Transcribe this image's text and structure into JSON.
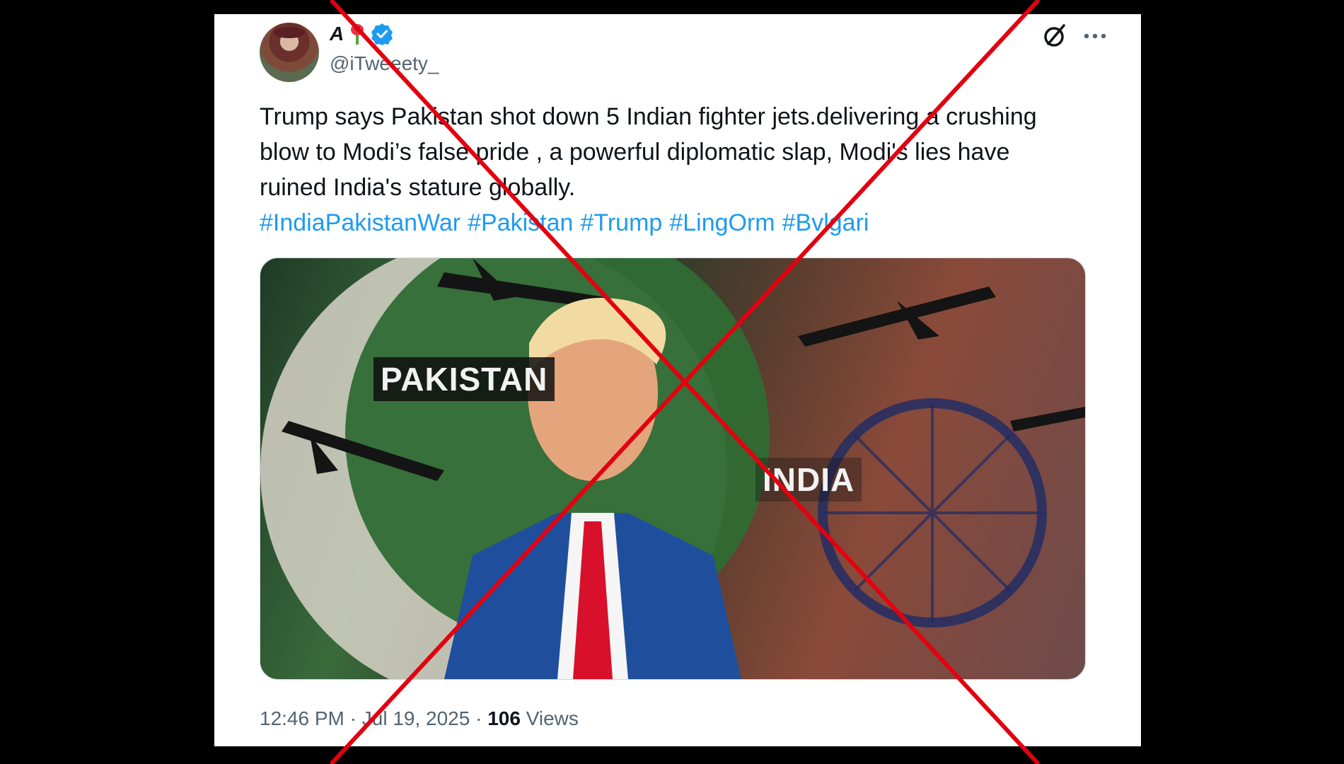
{
  "tweet": {
    "display_name": "A",
    "handle": "@iTweeety_",
    "verified": true,
    "text_lines": [
      "Trump says Pakistan shot down 5 Indian fighter jets.delivering a crushing",
      "blow to Modi’s false pride , a powerful diplomatic slap, Modi's lies have",
      "ruined India's stature globally."
    ],
    "hashtags": [
      "#IndiaPakistanWar",
      "#Pakistan",
      "#Trump",
      "#LingOrm",
      "#Bvlgari"
    ],
    "media": {
      "label_left": "PAKISTAN",
      "label_right": "INDIA"
    },
    "time": "12:46 PM",
    "date": "Jul 19, 2025",
    "separator": "·",
    "views_count": "106",
    "views_label": "Views"
  },
  "icons": {
    "verified": "verified-badge-icon",
    "grok": "grok-icon",
    "more": "more-options-icon",
    "flower": "flower-emoji-icon"
  },
  "colors": {
    "link": "#1d9bf0",
    "text": "#0f1419",
    "secondary": "#536471",
    "cross": "#e3000f"
  }
}
